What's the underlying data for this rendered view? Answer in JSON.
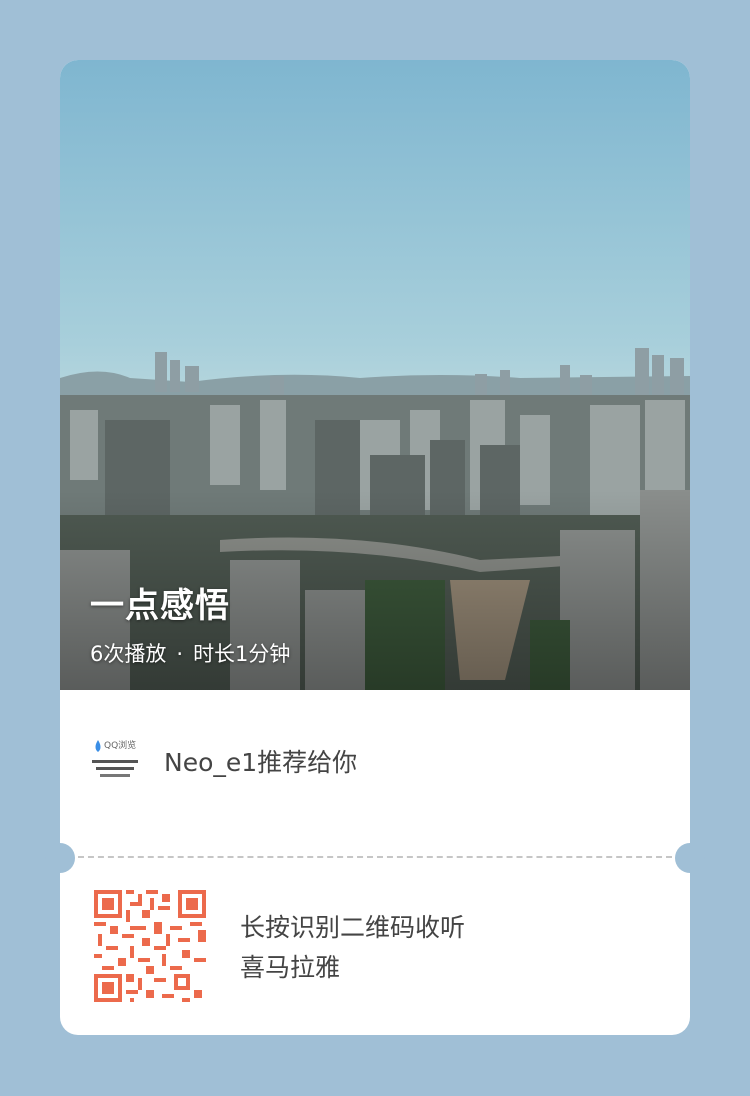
{
  "album": {
    "title": "一点感悟",
    "plays": "6次播放",
    "separator": "·",
    "duration": "时长1分钟"
  },
  "recommender": {
    "avatar_caption": "QQ浏览",
    "text": "Neo_e1推荐给你"
  },
  "footer": {
    "line1": "长按识别二维码收听",
    "line2": "喜马拉雅"
  },
  "colors": {
    "background": "#a0bfd6",
    "card": "#ffffff",
    "qr": "#ec6a4c",
    "text": "#444444"
  }
}
